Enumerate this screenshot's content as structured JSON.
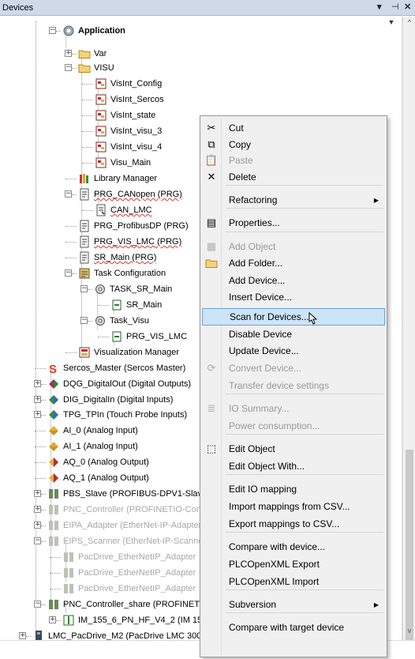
{
  "panel": {
    "title": "Devices",
    "controls": {
      "dropdown": "▾",
      "pin": "📌",
      "close": "✕"
    }
  },
  "tree": [
    {
      "label": "Application",
      "bold": true
    },
    {
      "label": "Var"
    },
    {
      "label": "VISU"
    },
    {
      "label": "VisInt_Config"
    },
    {
      "label": "VisInt_Sercos"
    },
    {
      "label": "VisInt_state"
    },
    {
      "label": "VisInt_visu_3"
    },
    {
      "label": "VisInt_visu_4"
    },
    {
      "label": "Visu_Main"
    },
    {
      "label": "Library Manager"
    },
    {
      "label": "PRG_CANopen (PRG)"
    },
    {
      "label": "CAN_LMC"
    },
    {
      "label": "PRG_ProfibusDP (PRG)"
    },
    {
      "label": "PRG_VIS_LMC (PRG)"
    },
    {
      "label": "SR_Main (PRG)"
    },
    {
      "label": "Task Configuration"
    },
    {
      "label": "TASK_SR_Main"
    },
    {
      "label": "SR_Main"
    },
    {
      "label": "Task_Visu"
    },
    {
      "label": "PRG_VIS_LMC"
    },
    {
      "label": "Visualization Manager"
    },
    {
      "label": "Sercos_Master (Sercos Master)"
    },
    {
      "label": "DQG_DigitalOut (Digital Outputs)"
    },
    {
      "label": "DIG_DigitalIn (Digital Inputs)"
    },
    {
      "label": "TPG_TPIn (Touch Probe Inputs)"
    },
    {
      "label": "AI_0 (Analog Input)"
    },
    {
      "label": "AI_1 (Analog Input)"
    },
    {
      "label": "AQ_0 (Analog Output)"
    },
    {
      "label": "AQ_1 (Analog Output)"
    },
    {
      "label": "PBS_Slave (PROFIBUS-DPV1-Slave)"
    },
    {
      "label": "PNC_Controller (PROFINETIO-Controller)"
    },
    {
      "label": "EIPA_Adapter (EtherNet-IP-Adapter)"
    },
    {
      "label": "EIPS_Scanner (EtherNet-IP-Scanner)"
    },
    {
      "label": "PacDrive_EtherNetIP_Adapter"
    },
    {
      "label": "PacDrive_EtherNetIP_Adapter"
    },
    {
      "label": "PacDrive_EtherNetIP_Adapter"
    },
    {
      "label": "PNC_Controller_share (PROFINETIO)"
    },
    {
      "label": "IM_155_6_PN_HF_V4_2 (IM 155-6)"
    },
    {
      "label": "LMC_PacDrive_M2 (PacDrive LMC 300C)"
    }
  ],
  "context_menu": {
    "items": [
      {
        "label": "Cut",
        "icon": "scissors-icon",
        "glyph": "✂",
        "enabled": true
      },
      {
        "label": "Copy",
        "icon": "copy-icon",
        "glyph": "⧉",
        "enabled": true
      },
      {
        "label": "Paste",
        "icon": "paste-icon",
        "glyph": "📋",
        "enabled": false
      },
      {
        "label": "Delete",
        "icon": "delete-icon",
        "glyph": "✕",
        "enabled": true
      },
      {
        "label": "Refactoring",
        "submenu": true,
        "enabled": true
      },
      {
        "label": "Properties...",
        "icon": "properties-icon",
        "glyph": "▤",
        "enabled": true
      },
      {
        "label": "Add Object",
        "icon": "add-object-icon",
        "glyph": "▦",
        "enabled": false
      },
      {
        "label": "Add Folder...",
        "icon": "folder-icon",
        "glyph": "",
        "enabled": true
      },
      {
        "label": "Add Device...",
        "enabled": true
      },
      {
        "label": "Insert Device...",
        "enabled": true
      },
      {
        "label": "Scan for Devices...",
        "enabled": true,
        "highlighted": true
      },
      {
        "label": "Disable Device",
        "enabled": true
      },
      {
        "label": "Update Device...",
        "enabled": true
      },
      {
        "label": "Convert Device...",
        "icon": "convert-icon",
        "glyph": "⟳",
        "enabled": false
      },
      {
        "label": "Transfer device settings",
        "enabled": false
      },
      {
        "label": "IO Summary...",
        "icon": "io-summary-icon",
        "glyph": "≣",
        "enabled": false
      },
      {
        "label": "Power consumption...",
        "enabled": false
      },
      {
        "label": "Edit Object",
        "icon": "edit-object-icon",
        "glyph": "⬚",
        "enabled": true
      },
      {
        "label": "Edit Object With...",
        "enabled": true
      },
      {
        "label": "Edit IO mapping",
        "enabled": true
      },
      {
        "label": "Import mappings from CSV...",
        "enabled": true
      },
      {
        "label": "Export mappings to CSV...",
        "enabled": true
      },
      {
        "label": "Compare with device...",
        "enabled": true
      },
      {
        "label": "PLCOpenXML Export",
        "enabled": true
      },
      {
        "label": "PLCOpenXML Import",
        "enabled": true
      },
      {
        "label": "Subversion",
        "submenu": true,
        "enabled": true
      },
      {
        "label": "Compare with target device",
        "enabled": true
      }
    ]
  }
}
